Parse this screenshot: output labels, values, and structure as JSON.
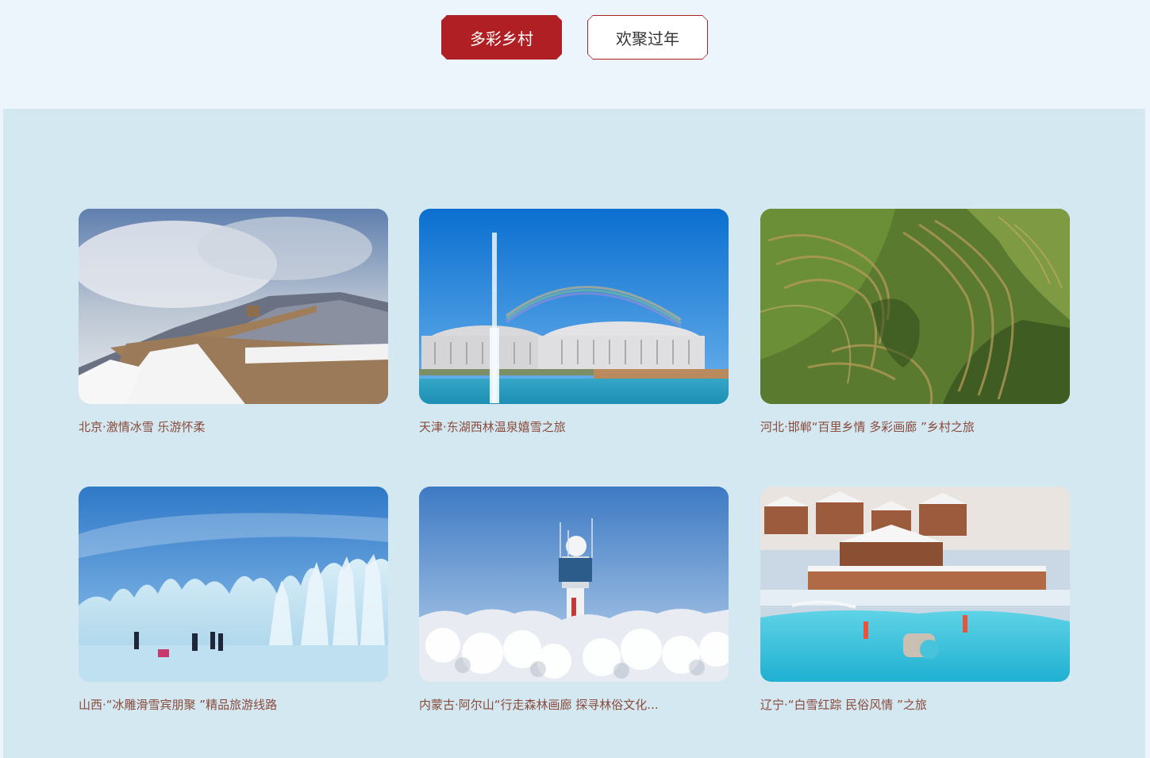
{
  "tabs": [
    {
      "label": "多彩乡村",
      "active": true
    },
    {
      "label": "欢聚过年",
      "active": false
    }
  ],
  "colors": {
    "accent": "#b01f24",
    "page_background": "#edf5fc",
    "content_background": "#d3e8f0",
    "caption_text": "#8a4a3c"
  },
  "cards": [
    {
      "title": "北京·激情冰雪 乐游怀柔",
      "image": "great-wall-snow-photo"
    },
    {
      "title": "天津·东湖西林温泉嬉雪之旅",
      "image": "stadium-fountain-rainbow-photo"
    },
    {
      "title": "河北·邯郸“百里乡情 多彩画廊 ”乡村之旅",
      "image": "terraced-hills-aerial-photo"
    },
    {
      "title": "山西·“冰雕滑雪宾朋聚 ”精品旅游线路",
      "image": "ice-sculpture-skating-photo"
    },
    {
      "title": "内蒙古·阿尔山“行走森林画廊 探寻林俗文化...",
      "image": "radar-tower-frosted-forest-photo"
    },
    {
      "title": "辽宁·“白雪红踪 民俗风情 ”之旅",
      "image": "snowy-resort-pool-photo"
    }
  ]
}
